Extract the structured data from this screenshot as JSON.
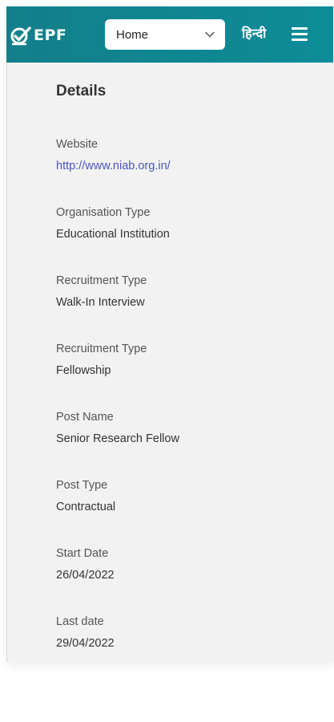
{
  "header": {
    "logo_text": "EPF",
    "nav_select": {
      "selected": "Home"
    },
    "language_link": "हिन्दी",
    "menu_icon": "hamburger-menu-icon",
    "background_color": "#0d8c98"
  },
  "details": {
    "title": "Details",
    "fields": [
      {
        "label": "Website",
        "value": "http://www.niab.org.in/",
        "is_link": true
      },
      {
        "label": "Organisation Type",
        "value": "Educational Institution"
      },
      {
        "label": "Recruitment Type",
        "value": "Walk-In Interview"
      },
      {
        "label": "Recruitment Type",
        "value": "Fellowship"
      },
      {
        "label": "Post Name",
        "value": "Senior Research Fellow"
      },
      {
        "label": "Post Type",
        "value": "Contractual"
      },
      {
        "label": "Start Date",
        "value": "26/04/2022"
      },
      {
        "label": "Last date",
        "value": "29/04/2022"
      }
    ]
  }
}
